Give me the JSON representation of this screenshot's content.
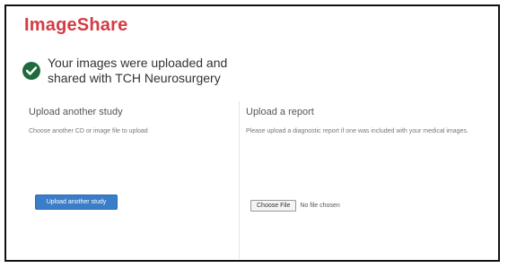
{
  "brand": "ImageShare",
  "success": {
    "icon": "check-icon",
    "message": "Your images were uploaded and shared with TCH Neurosurgery"
  },
  "left_panel": {
    "title": "Upload another study",
    "description": "Choose another CD or image file to upload",
    "button_label": "Upload another study"
  },
  "right_panel": {
    "title": "Upload a report",
    "description": "Please upload a diagnostic report if one was included with your medical images.",
    "choose_file_label": "Choose File",
    "no_file_text": "No file chosen"
  },
  "colors": {
    "brand": "#d43c43",
    "success": "#1f6b3c",
    "button": "#3a7dc8"
  }
}
